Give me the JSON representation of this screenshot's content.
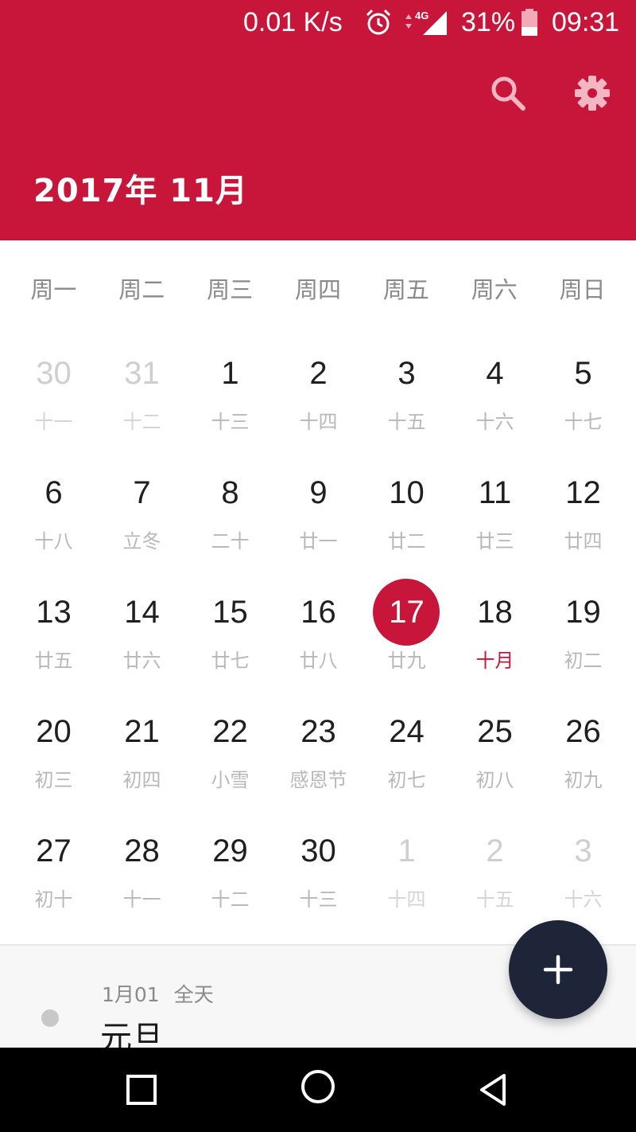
{
  "status_bar": {
    "net_speed": "0.01 K/s",
    "network_type": "4G",
    "battery": "31%",
    "time": "09:31"
  },
  "header": {
    "month_title": "2017年  11月",
    "icons": [
      "search-icon",
      "settings-icon"
    ],
    "background_color": "#c8163a"
  },
  "weekdays": [
    "周一",
    "周二",
    "周三",
    "周四",
    "周五",
    "周六",
    "周日"
  ],
  "days": [
    {
      "day": "30",
      "lunar": "十一",
      "muted": true
    },
    {
      "day": "31",
      "lunar": "十二",
      "muted": true
    },
    {
      "day": "1",
      "lunar": "十三"
    },
    {
      "day": "2",
      "lunar": "十四"
    },
    {
      "day": "3",
      "lunar": "十五"
    },
    {
      "day": "4",
      "lunar": "十六"
    },
    {
      "day": "5",
      "lunar": "十七"
    },
    {
      "day": "6",
      "lunar": "十八"
    },
    {
      "day": "7",
      "lunar": "立冬"
    },
    {
      "day": "8",
      "lunar": "二十"
    },
    {
      "day": "9",
      "lunar": "廿一"
    },
    {
      "day": "10",
      "lunar": "廿二"
    },
    {
      "day": "11",
      "lunar": "廿三"
    },
    {
      "day": "12",
      "lunar": "廿四"
    },
    {
      "day": "13",
      "lunar": "廿五"
    },
    {
      "day": "14",
      "lunar": "廿六"
    },
    {
      "day": "15",
      "lunar": "廿七"
    },
    {
      "day": "16",
      "lunar": "廿八"
    },
    {
      "day": "17",
      "lunar": "廿九",
      "today": true
    },
    {
      "day": "18",
      "lunar": "十月",
      "lunar_highlight": true
    },
    {
      "day": "19",
      "lunar": "初二"
    },
    {
      "day": "20",
      "lunar": "初三"
    },
    {
      "day": "21",
      "lunar": "初四"
    },
    {
      "day": "22",
      "lunar": "小雪"
    },
    {
      "day": "23",
      "lunar": "感恩节"
    },
    {
      "day": "24",
      "lunar": "初七"
    },
    {
      "day": "25",
      "lunar": "初八"
    },
    {
      "day": "26",
      "lunar": "初九"
    },
    {
      "day": "27",
      "lunar": "初十"
    },
    {
      "day": "28",
      "lunar": "十一"
    },
    {
      "day": "29",
      "lunar": "十二"
    },
    {
      "day": "30",
      "lunar": "十三"
    },
    {
      "day": "1",
      "lunar": "十四",
      "muted": true
    },
    {
      "day": "2",
      "lunar": "十五",
      "muted": true
    },
    {
      "day": "3",
      "lunar": "十六",
      "muted": true
    }
  ],
  "event": {
    "date": "1月01",
    "time": "全天",
    "title": "元旦",
    "icon": "event-dot-icon"
  },
  "fab": {
    "icon": "plus-icon",
    "color": "#1f2538"
  },
  "nav_bar": {
    "icons": [
      "recent-apps-icon",
      "home-icon",
      "back-icon"
    ]
  }
}
